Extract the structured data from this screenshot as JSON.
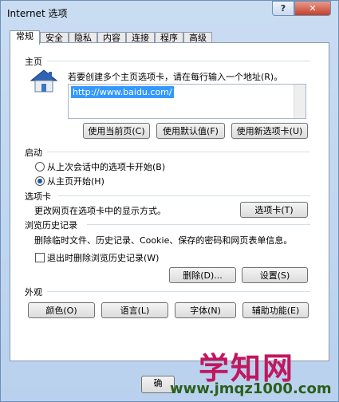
{
  "window": {
    "title": "Internet 选项",
    "help_label": "?",
    "close_label": "✕"
  },
  "tabs": [
    "常规",
    "安全",
    "隐私",
    "内容",
    "连接",
    "程序",
    "高级"
  ],
  "home": {
    "section_label": "主页",
    "instruction": "若要创建多个主页选项卡，请在每行输入一个地址(R)。",
    "url": "http://www.baidu.com/",
    "buttons": {
      "use_current": "使用当前页(C)",
      "use_default": "使用默认值(F)",
      "use_new_tab": "使用新选项卡(U)"
    }
  },
  "startup": {
    "section_label": "启动",
    "option_last_session": "从上次会话中的选项卡开始(B)",
    "option_home": "从主页开始(H)",
    "selected": "home"
  },
  "tabs_section": {
    "section_label": "选项卡",
    "description": "更改网页在选项卡中的显示方式。",
    "button": "选项卡(T)"
  },
  "history": {
    "section_label": "浏览历史记录",
    "description": "删除临时文件、历史记录、Cookie、保存的密码和网页表单信息。",
    "checkbox_label": "退出时删除浏览历史记录(W)",
    "checkbox_checked": false,
    "delete_button": "删除(D)...",
    "settings_button": "设置(S)"
  },
  "appearance": {
    "section_label": "外观",
    "colors": "颜色(O)",
    "languages": "语言(L)",
    "fonts": "字体(N)",
    "accessibility": "辅助功能(E)"
  },
  "footer": {
    "ok_peek": "确"
  },
  "watermark": {
    "text": "学知网",
    "url": "www.jmqz1000.com"
  }
}
